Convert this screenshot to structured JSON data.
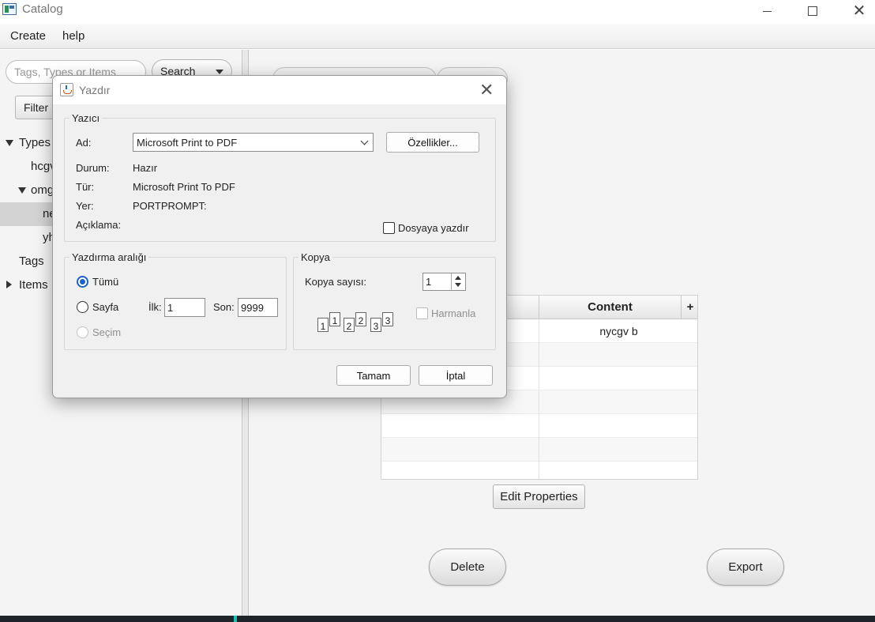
{
  "window": {
    "title": "Catalog"
  },
  "menu": {
    "create": "Create",
    "help": "help"
  },
  "left": {
    "search_placeholder": "Tags, Types or Items",
    "search_button": "Search",
    "filter_button": "Filter",
    "tree": [
      {
        "label": "Types",
        "expanded": true
      },
      {
        "label": "hcgv"
      },
      {
        "label": "omg",
        "expanded": true
      },
      {
        "label": "ne",
        "selected": true
      },
      {
        "label": "yh"
      },
      {
        "label": "Tags"
      },
      {
        "label": "Items",
        "expanded": false
      }
    ]
  },
  "main": {
    "table": {
      "content_header": "Content",
      "plus": "+",
      "rows": [
        {
          "content": "nycgv b"
        }
      ]
    },
    "edit_properties": "Edit Properties",
    "delete": "Delete",
    "export": "Export"
  },
  "dialog": {
    "title": "Yazdır",
    "printer_group": "Yazıcı",
    "name_label": "Ad:",
    "printer_name": "Microsoft Print to PDF",
    "properties_button": "Özellikler...",
    "status_label": "Durum:",
    "status_value": "Hazır",
    "type_label": "Tür:",
    "type_value": "Microsoft Print To PDF",
    "location_label": "Yer:",
    "location_value": "PORTPROMPT:",
    "comment_label": "Açıklama:",
    "print_to_file": "Dosyaya yazdır",
    "range_group": "Yazdırma aralığı",
    "range_all": "Tümü",
    "range_pages": "Sayfa",
    "from_label": "İlk:",
    "from_value": "1",
    "to_label": "Son:",
    "to_value": "9999",
    "range_selection": "Seçim",
    "copies_group": "Kopya",
    "copies_label": "Kopya sayısı:",
    "copies_value": "1",
    "collate": "Harmanla",
    "collate_pages": [
      "1",
      "1",
      "2",
      "2",
      "3",
      "3"
    ],
    "ok": "Tamam",
    "cancel": "İptal"
  }
}
